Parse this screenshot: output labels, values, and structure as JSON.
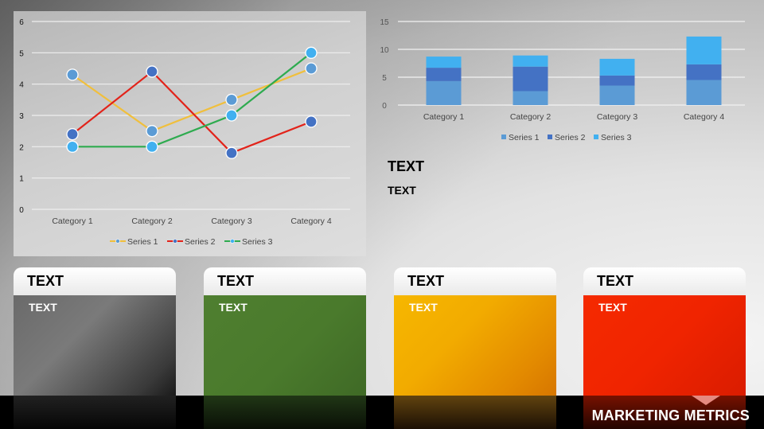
{
  "chart_data": [
    {
      "type": "line",
      "categories": [
        "Category 1",
        "Category 2",
        "Category 3",
        "Category 4"
      ],
      "series": [
        {
          "name": "Series 1",
          "values": [
            4.3,
            2.5,
            3.5,
            4.5
          ],
          "line_color": "#f0bf3c",
          "marker_color": "#5b9bd5"
        },
        {
          "name": "Series 2",
          "values": [
            2.4,
            4.4,
            1.8,
            2.8
          ],
          "line_color": "#e2231a",
          "marker_color": "#4472c4"
        },
        {
          "name": "Series 3",
          "values": [
            2.0,
            2.0,
            3.0,
            5.0
          ],
          "line_color": "#2eab4f",
          "marker_color": "#41b0f0"
        }
      ],
      "ylim": [
        0,
        6
      ],
      "yticks": [
        0,
        1,
        2,
        3,
        4,
        5,
        6
      ],
      "grid": true,
      "legend": "bottom",
      "title": "",
      "xlabel": "",
      "ylabel": ""
    },
    {
      "type": "bar",
      "stacked": true,
      "categories": [
        "Category 1",
        "Category 2",
        "Category 3",
        "Category 4"
      ],
      "series": [
        {
          "name": "Series 1",
          "values": [
            4.3,
            2.5,
            3.5,
            4.5
          ],
          "color": "#5b9bd5"
        },
        {
          "name": "Series 2",
          "values": [
            2.4,
            4.4,
            1.8,
            2.8
          ],
          "color": "#4472c4"
        },
        {
          "name": "Series 3",
          "values": [
            2.0,
            2.0,
            3.0,
            5.0
          ],
          "color": "#41b0f0"
        }
      ],
      "ylim": [
        0,
        15
      ],
      "yticks": [
        0,
        5,
        10,
        15
      ],
      "grid": true,
      "legend": "bottom",
      "title": "",
      "xlabel": "",
      "ylabel": ""
    }
  ],
  "side_text": {
    "title": "TEXT",
    "subtitle": "TEXT"
  },
  "cards": [
    {
      "title": "TEXT",
      "text": "TEXT",
      "color": "gray"
    },
    {
      "title": "TEXT",
      "text": "TEXT",
      "color": "green"
    },
    {
      "title": "TEXT",
      "text": "TEXT",
      "color": "yellow"
    },
    {
      "title": "TEXT",
      "text": "TEXT",
      "color": "red"
    }
  ],
  "footer": {
    "title": "MARKETING METRICS"
  }
}
